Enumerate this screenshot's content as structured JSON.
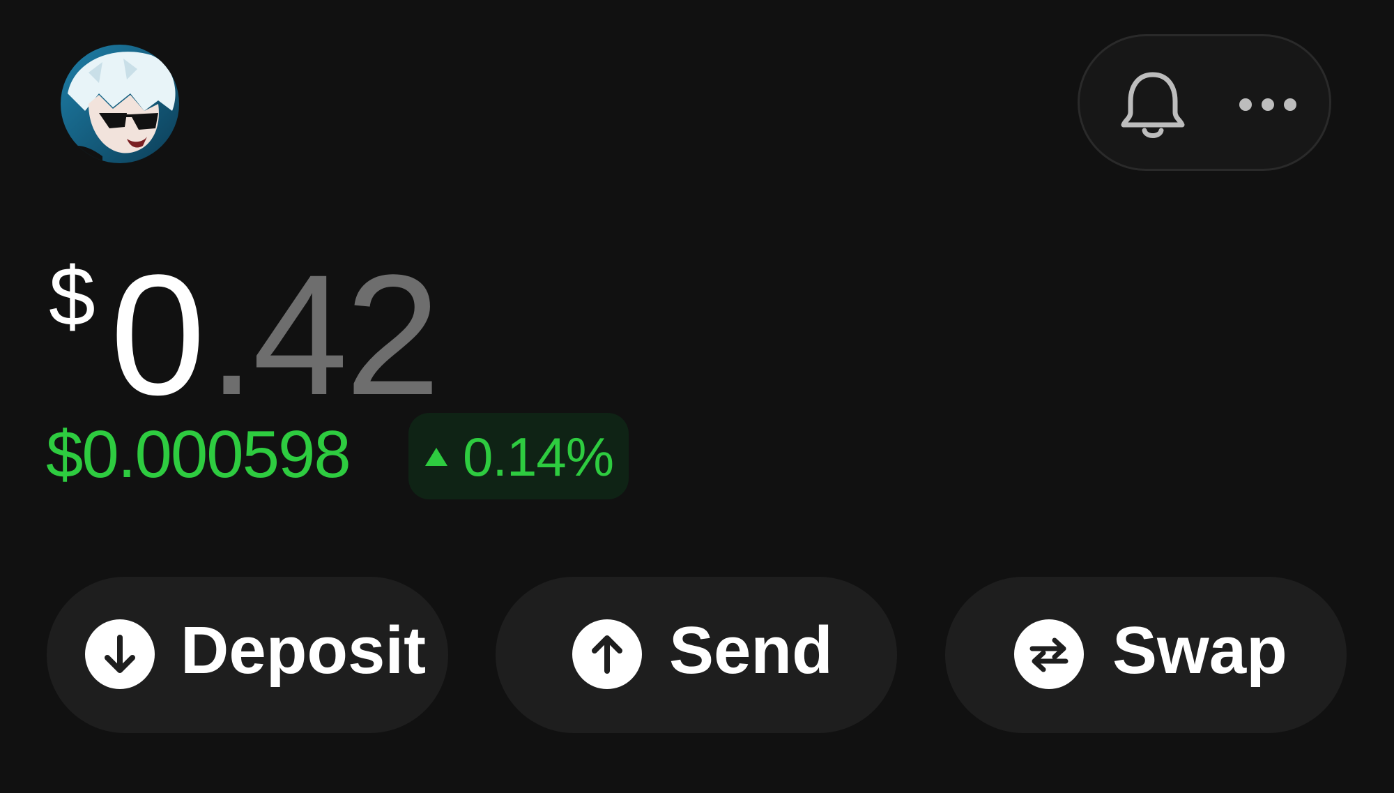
{
  "header": {
    "avatar_icon": "avatar-anime-character",
    "notifications_icon": "bell-icon",
    "more_icon": "more-horizontal-icon"
  },
  "balance": {
    "currency_symbol": "$",
    "whole": "0",
    "fraction": ".42"
  },
  "price": {
    "value": "$0.000598",
    "change": "0.14%",
    "change_direction": "up",
    "change_color": "#2ecc40"
  },
  "actions": [
    {
      "label": "Deposit",
      "icon": "arrow-down-circle-icon"
    },
    {
      "label": "Send",
      "icon": "arrow-up-circle-icon"
    },
    {
      "label": "Swap",
      "icon": "swap-arrows-icon"
    }
  ],
  "colors": {
    "background": "#111111",
    "positive": "#2ecc40",
    "button_bg": "#1e1e1e",
    "muted_text": "#6e6e6e"
  }
}
